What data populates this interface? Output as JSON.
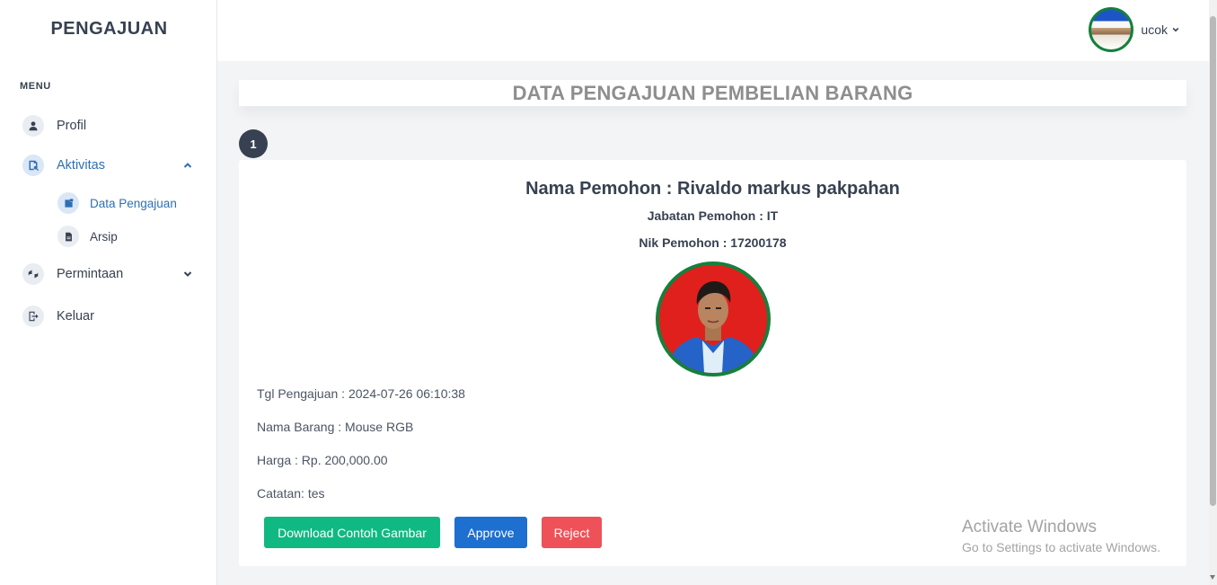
{
  "sidebar": {
    "brand": "PENGAJUAN",
    "menu_heading": "MENU",
    "items": [
      {
        "label": "Profil",
        "icon": "user-icon"
      },
      {
        "label": "Aktivitas",
        "icon": "activity-icon",
        "expanded": true
      },
      {
        "label": "Permintaan",
        "icon": "request-icon",
        "expanded": false
      },
      {
        "label": "Keluar",
        "icon": "logout-icon"
      }
    ],
    "sub_items": [
      {
        "label": "Data Pengajuan",
        "icon": "data-icon",
        "active": true
      },
      {
        "label": "Arsip",
        "icon": "file-icon"
      }
    ]
  },
  "topbar": {
    "username": "ucok"
  },
  "main": {
    "page_title": "DATA PENGAJUAN PEMBELIAN BARANG",
    "entry_number": "1",
    "card": {
      "name_line": "Nama Pemohon : Rivaldo markus pakpahan",
      "position_line": "Jabatan Pemohon : IT",
      "nik_line": "Nik Pemohon : 17200178",
      "date_line": "Tgl Pengajuan : 2024-07-26 06:10:38",
      "item_line": "Nama Barang : Mouse RGB",
      "price_line": "Harga : Rp. 200,000.00",
      "note_line": "Catatan: tes",
      "buttons": {
        "download": "Download Contoh Gambar",
        "approve": "Approve",
        "reject": "Reject"
      }
    }
  },
  "watermark": {
    "title": "Activate Windows",
    "subtitle": "Go to Settings to activate Windows."
  },
  "colors": {
    "accent_blue": "#2e6fb3",
    "approve": "#1d6fd0",
    "download": "#10b981",
    "reject": "#ef5158",
    "avatar_ring": "#15803d"
  }
}
